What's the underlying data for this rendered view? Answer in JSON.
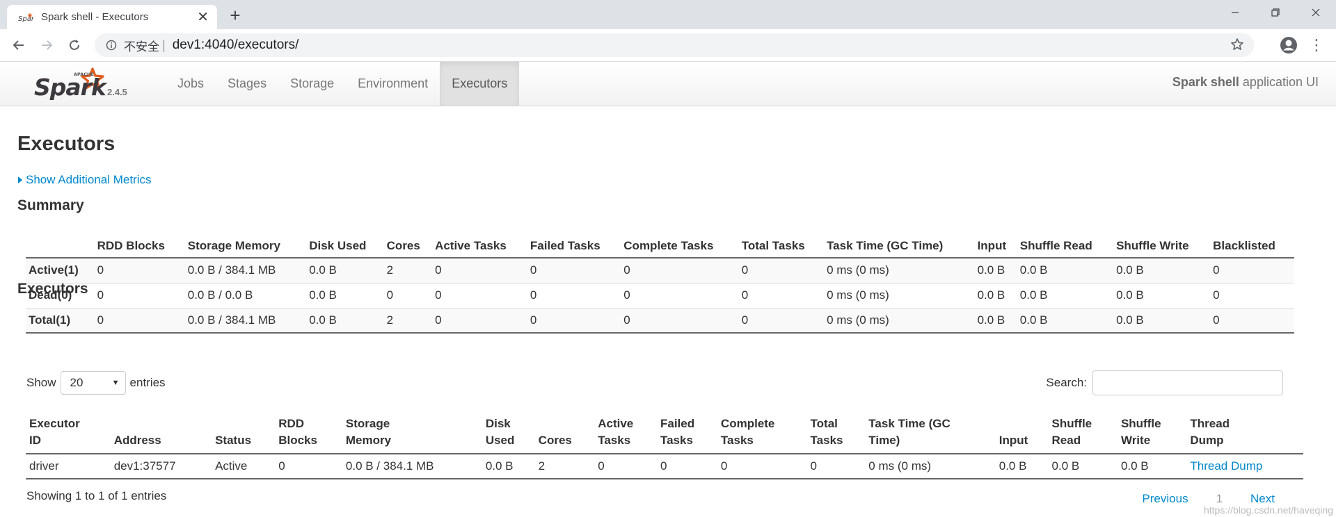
{
  "browser": {
    "tab_title": "Spark shell - Executors",
    "url_security_label": "不安全",
    "url": "dev1:4040/executors/"
  },
  "spark_nav": {
    "logo_top_text": "APACHE",
    "logo_text": "Spark",
    "version": "2.4.5",
    "tabs": [
      {
        "label": "Jobs",
        "active": false
      },
      {
        "label": "Stages",
        "active": false
      },
      {
        "label": "Storage",
        "active": false
      },
      {
        "label": "Environment",
        "active": false
      },
      {
        "label": "Executors",
        "active": true
      }
    ],
    "app_name": "Spark shell",
    "app_suffix": "application UI"
  },
  "page": {
    "title": "Executors",
    "additional_metrics_link": "Show Additional Metrics",
    "summary_heading": "Summary",
    "executors_heading": "Executors"
  },
  "summary": {
    "columns": [
      "",
      "RDD Blocks",
      "Storage Memory",
      "Disk Used",
      "Cores",
      "Active Tasks",
      "Failed Tasks",
      "Complete Tasks",
      "Total Tasks",
      "Task Time (GC Time)",
      "Input",
      "Shuffle Read",
      "Shuffle Write",
      "Blacklisted"
    ],
    "rows": [
      [
        "Active(1)",
        "0",
        "0.0 B / 384.1 MB",
        "0.0 B",
        "2",
        "0",
        "0",
        "0",
        "0",
        "0 ms (0 ms)",
        "0.0 B",
        "0.0 B",
        "0.0 B",
        "0"
      ],
      [
        "Dead(0)",
        "0",
        "0.0 B / 0.0 B",
        "0.0 B",
        "0",
        "0",
        "0",
        "0",
        "0",
        "0 ms (0 ms)",
        "0.0 B",
        "0.0 B",
        "0.0 B",
        "0"
      ],
      [
        "Total(1)",
        "0",
        "0.0 B / 384.1 MB",
        "0.0 B",
        "2",
        "0",
        "0",
        "0",
        "0",
        "0 ms (0 ms)",
        "0.0 B",
        "0.0 B",
        "0.0 B",
        "0"
      ]
    ]
  },
  "executors": {
    "show_label": "Show",
    "page_size": "20",
    "entries_label": "entries",
    "search_label": "Search:",
    "search_value": "",
    "columns": [
      [
        "Executor",
        "ID"
      ],
      [
        "",
        "Address"
      ],
      [
        "",
        "Status"
      ],
      [
        "RDD",
        "Blocks"
      ],
      [
        "Storage",
        "Memory"
      ],
      [
        "Disk",
        "Used"
      ],
      [
        "",
        "Cores"
      ],
      [
        "Active",
        "Tasks"
      ],
      [
        "Failed",
        "Tasks"
      ],
      [
        "Complete",
        "Tasks"
      ],
      [
        "Total",
        "Tasks"
      ],
      [
        "Task Time (GC",
        "Time)"
      ],
      [
        "",
        "Input"
      ],
      [
        "Shuffle",
        "Read"
      ],
      [
        "Shuffle",
        "Write"
      ],
      [
        "Thread",
        "Dump"
      ]
    ],
    "rows": [
      [
        "driver",
        "dev1:37577",
        "Active",
        "0",
        "0.0 B / 384.1 MB",
        "0.0 B",
        "2",
        "0",
        "0",
        "0",
        "0",
        "0 ms (0 ms)",
        "0.0 B",
        "0.0 B",
        "0.0 B",
        "Thread Dump"
      ]
    ],
    "showing_info": "Showing 1 to 1 of 1 entries",
    "pager": {
      "previous": "Previous",
      "current": "1",
      "next": "Next"
    }
  },
  "watermark": "https://blog.csdn.net/haveqing",
  "colors": {
    "link": "#0088cc",
    "spark_orange": "#e25a1c",
    "chrome_bg": "#dee1e6"
  }
}
